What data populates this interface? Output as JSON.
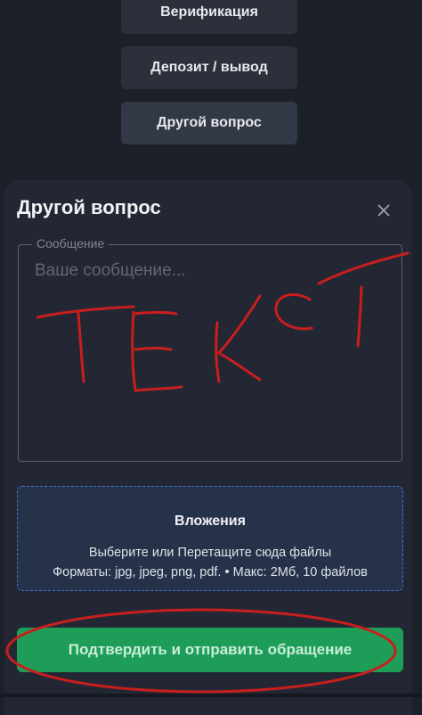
{
  "top_buttons": {
    "verification": "Верификация",
    "deposit": "Депозит / вывод",
    "other": "Другой вопрос"
  },
  "modal": {
    "title": "Другой вопрос",
    "message": {
      "legend": "Сообщение",
      "placeholder": "Ваше сообщение..."
    },
    "attachments": {
      "title": "Вложения",
      "line1": "Выберите или Перетащите сюда файлы",
      "line2": "Форматы: jpg, jpeg, png, pdf. • Макс: 2Мб, 10 файлов"
    },
    "submit_label": "Подтвердить и отправить обращение"
  },
  "annotation": {
    "handwritten_text": "ТЕКСТ",
    "ink_color": "#c81e1e"
  },
  "colors": {
    "accent_green": "#1e9d58",
    "dropzone_border": "#3e74c9"
  }
}
